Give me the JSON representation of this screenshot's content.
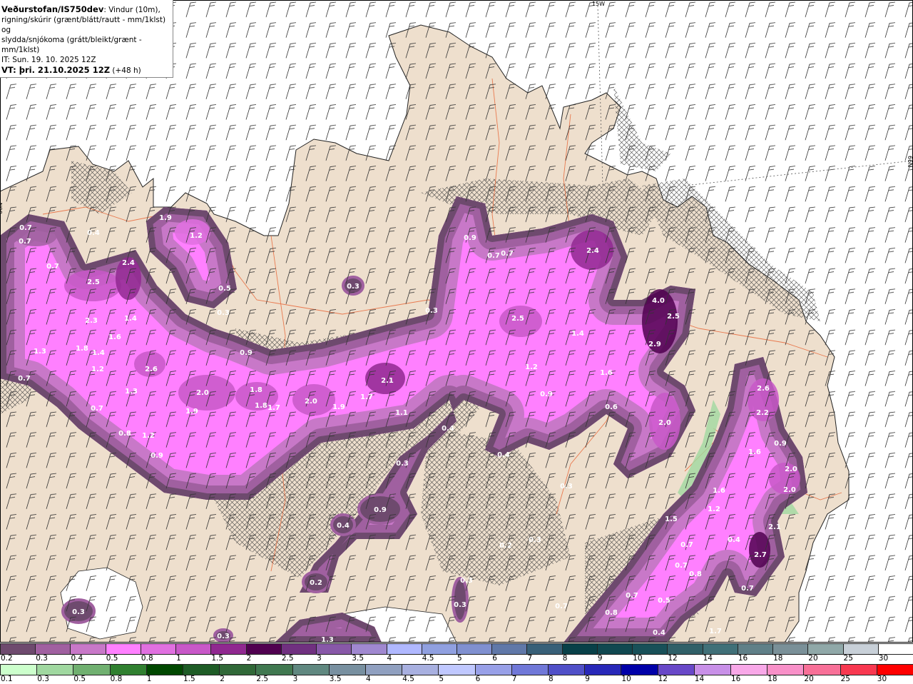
{
  "header": {
    "source": "Veðurstofan/IS750dev",
    "description_line1": ": Vindur (10m),",
    "description_line2": "rigning/skúrir (grænt/blátt/rautt - mm/1klst) og",
    "description_line3": "slydda/snjókoma (grátt/bleikt/grænt - mm/1klst)",
    "initial_time": "IT: Sun. 19. 10. 2025 12Z",
    "valid_time": "VT: þri. 21.10.2025 12Z",
    "lead_time": "(+48 h)"
  },
  "map": {
    "longitude_label": "15W",
    "latitude_label": "66N",
    "colors": {
      "land": "#eedfcd",
      "sea": "#ffffff",
      "coast": "#222222",
      "roads": "#e8683a",
      "wind_barbs": "#333333"
    },
    "precip_labels": [
      "0.7",
      "0.4",
      "0.7",
      "0.7",
      "1.9",
      "1.2",
      "2.4",
      "2.5",
      "0.5",
      "0.3",
      "0.3",
      "2.3",
      "1.4",
      "1.6",
      "1.8",
      "1.4",
      "1.3",
      "0.9",
      "1.2",
      "2.6",
      "0.7",
      "1.3",
      "2.0",
      "1.8",
      "2.1",
      "1.9",
      "1.8",
      "1.7",
      "2.0",
      "1.9",
      "1.7",
      "1.1",
      "0.7",
      "0.8",
      "1.2",
      "0.9",
      "0.9",
      "0.7",
      "0.7",
      "2.4",
      "0.3",
      "2.5",
      "1.4",
      "4.0",
      "2.5",
      "2.9",
      "1.2",
      "1.6",
      "0.9",
      "0.6",
      "2.0",
      "0.4",
      "0.4",
      "0.3",
      "0.3",
      "0.9",
      "0.4",
      "0.3",
      "0.2",
      "0.3",
      "0.3",
      "0.2",
      "0.3",
      "0.3",
      "1.3",
      "2.6",
      "2.2",
      "1.6",
      "0.9",
      "2.0",
      "2.0",
      "1.6",
      "1.2",
      "1.5",
      "2.1",
      "0.4",
      "0.7",
      "2.7",
      "0.7",
      "0.8",
      "0.7",
      "0.7",
      "0.5",
      "0.8",
      "0.4",
      "1.7",
      "0.7"
    ]
  },
  "legend": {
    "snow_scale": {
      "ticks": [
        "0.2",
        "0.3",
        "0.4",
        "0.5",
        "0.8",
        "1",
        "1.5",
        "2",
        "2.5",
        "3",
        "3.5",
        "4",
        "4.5",
        "5",
        "6",
        "7",
        "8",
        "9",
        "10",
        "12",
        "14",
        "16",
        "18",
        "20",
        "25",
        "30"
      ],
      "colors": [
        "#6e4a6e",
        "#a060a0",
        "#c878c8",
        "#ff80ff",
        "#e070e0",
        "#c858c8",
        "#902890",
        "#500050",
        "#703080",
        "#8858a8",
        "#a088d0",
        "#b0b8ff",
        "#90a0e0",
        "#8090d0",
        "#6078a8",
        "#386078",
        "#084048",
        "#104850",
        "#185058",
        "#306068",
        "#407078",
        "#608088",
        "#7a9098",
        "#90a8a8",
        "#c8d0d8",
        "#ffffff"
      ]
    },
    "rain_scale": {
      "ticks": [
        "0.1",
        "0.3",
        "0.5",
        "0.8",
        "1",
        "1.5",
        "2",
        "2.5",
        "3",
        "3.5",
        "4",
        "4.5",
        "5",
        "6",
        "7",
        "8",
        "9",
        "10",
        "12",
        "14",
        "16",
        "18",
        "20",
        "25",
        "30"
      ],
      "colors": [
        "#ccffcc",
        "#a0d8a0",
        "#70b070",
        "#308030",
        "#004800",
        "#1e5c26",
        "#306838",
        "#407850",
        "#608880",
        "#7890a0",
        "#90a0c0",
        "#a8b0e0",
        "#c0c8ff",
        "#98a0e8",
        "#7078d8",
        "#5050c8",
        "#2828b8",
        "#0000a8",
        "#6848c8",
        "#c890e8",
        "#f8a8e8",
        "#f890c8",
        "#f87098",
        "#f83850",
        "#ff0000"
      ]
    }
  }
}
